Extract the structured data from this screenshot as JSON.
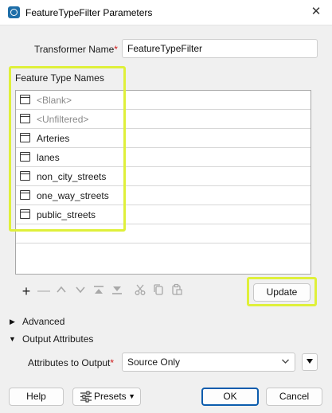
{
  "window": {
    "title": "FeatureTypeFilter Parameters",
    "close_glyph": "✕"
  },
  "transformer": {
    "label": "Transformer Name",
    "required_mark": "*",
    "value": "FeatureTypeFilter"
  },
  "feature_types": {
    "group_label": "Feature Type Names",
    "items": [
      {
        "label": "<Blank>",
        "placeholder": true
      },
      {
        "label": "<Unfiltered>",
        "placeholder": true
      },
      {
        "label": "Arteries",
        "placeholder": false
      },
      {
        "label": "lanes",
        "placeholder": false
      },
      {
        "label": "non_city_streets",
        "placeholder": false
      },
      {
        "label": "one_way_streets",
        "placeholder": false
      },
      {
        "label": "public_streets",
        "placeholder": false
      }
    ]
  },
  "toolbar": {
    "icons": [
      "add-icon",
      "remove-icon",
      "move-up-icon",
      "move-down-icon",
      "move-to-top-icon",
      "move-to-bottom-icon",
      "cut-icon",
      "copy-icon",
      "paste-icon"
    ],
    "update_label": "Update"
  },
  "advanced": {
    "label": "Advanced",
    "expanded": false
  },
  "output_attributes": {
    "label": "Output Attributes",
    "expanded": true,
    "attributes_label": "Attributes to Output",
    "required_mark": "*",
    "selected": "Source Only"
  },
  "footer": {
    "help_label": "Help",
    "presets_label": "Presets",
    "ok_label": "OK",
    "cancel_label": "Cancel"
  },
  "colors": {
    "highlight": "#dff03a",
    "default_button_border": "#0b5cad",
    "required": "#d01818"
  }
}
